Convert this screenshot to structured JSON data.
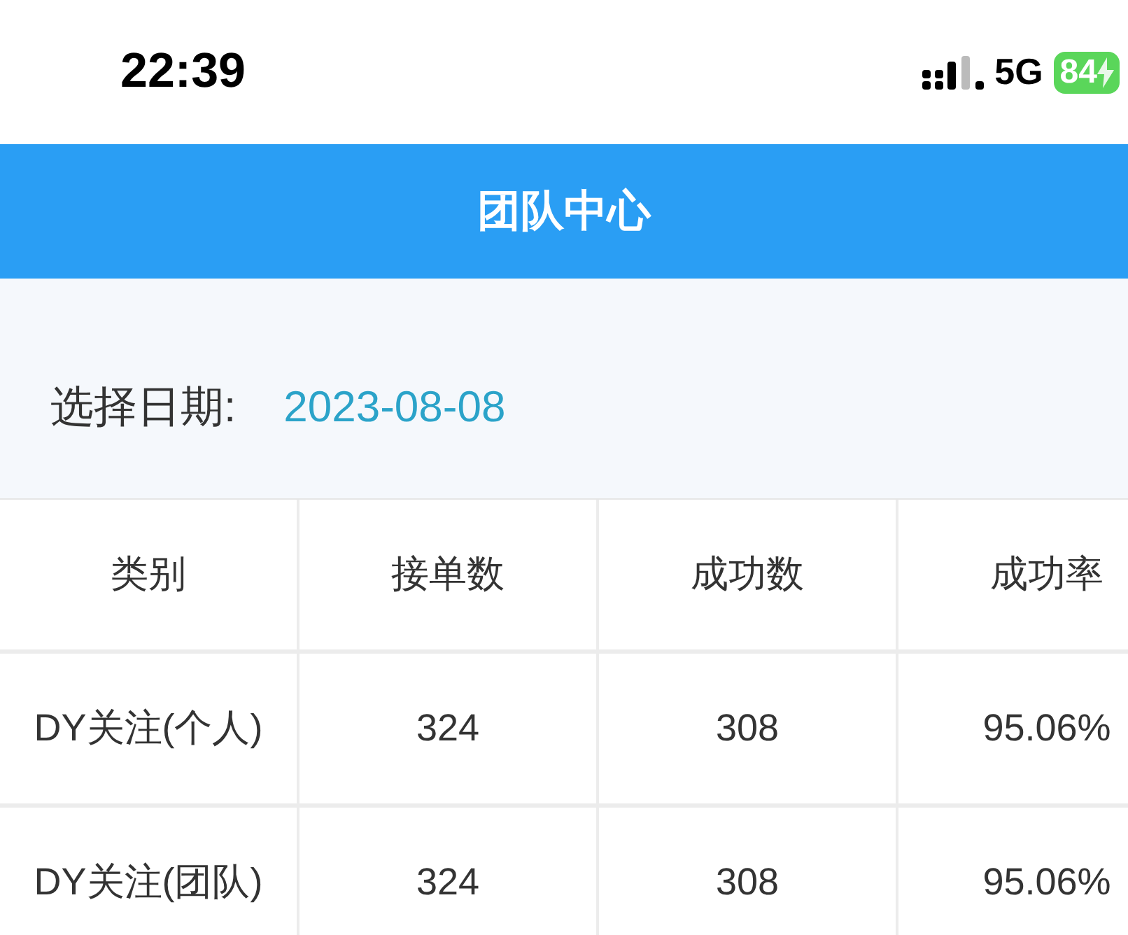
{
  "status_bar": {
    "time": "22:39",
    "network": "5G",
    "battery": "84"
  },
  "header": {
    "title": "团队中心"
  },
  "date_picker": {
    "label": "选择日期:",
    "value": "2023-08-08"
  },
  "table": {
    "columns": [
      "类别",
      "接单数",
      "成功数",
      "成功率"
    ],
    "rows": [
      [
        "DY关注(个人)",
        "324",
        "308",
        "95.06%"
      ],
      [
        "DY关注(团队)",
        "324",
        "308",
        "95.06%"
      ]
    ]
  }
}
